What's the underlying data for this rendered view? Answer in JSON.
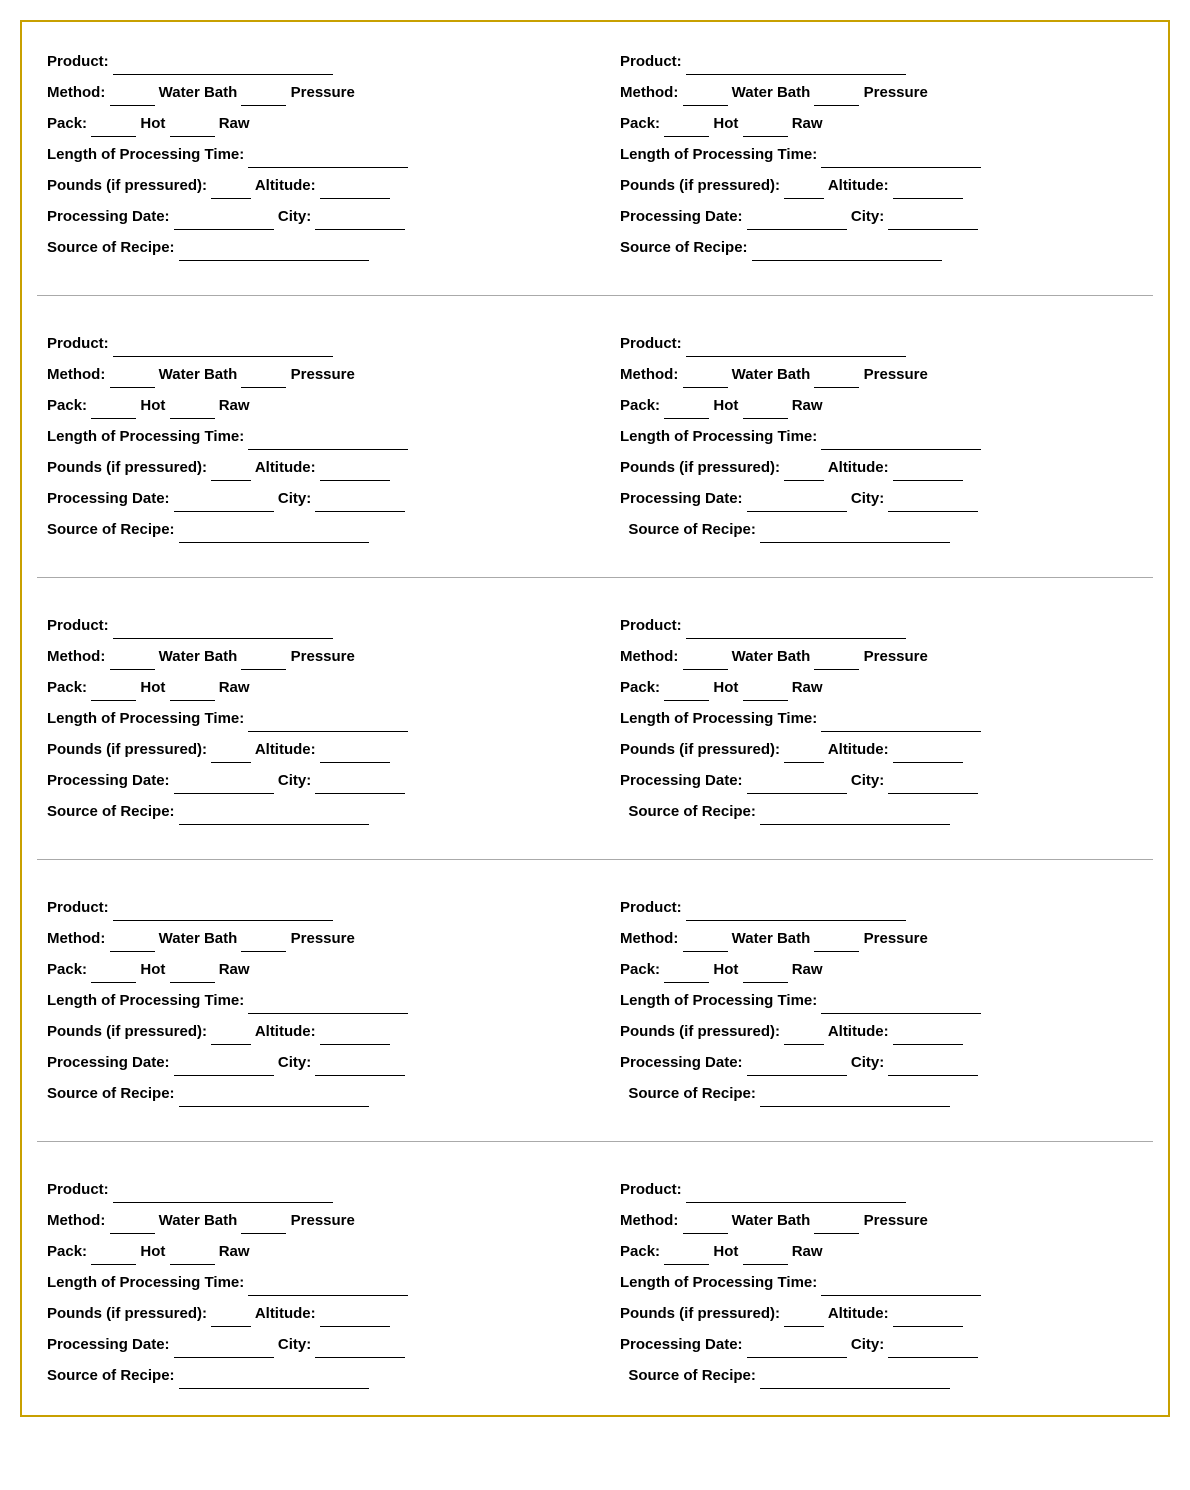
{
  "cards": [
    {
      "id": 1,
      "product_label": "Product:",
      "method_label": "Method:",
      "water_bath": "Water Bath",
      "pressure": "Pressure",
      "pack_label": "Pack:",
      "hot": "Hot",
      "raw": "Raw",
      "length_label": "Length of Processing Time:",
      "pounds_label": "Pounds (if pressured):",
      "altitude_label": "Altitude:",
      "procdate_label": "Processing Date:",
      "city_label": "City:",
      "source_label": "Source of Recipe:"
    }
  ]
}
